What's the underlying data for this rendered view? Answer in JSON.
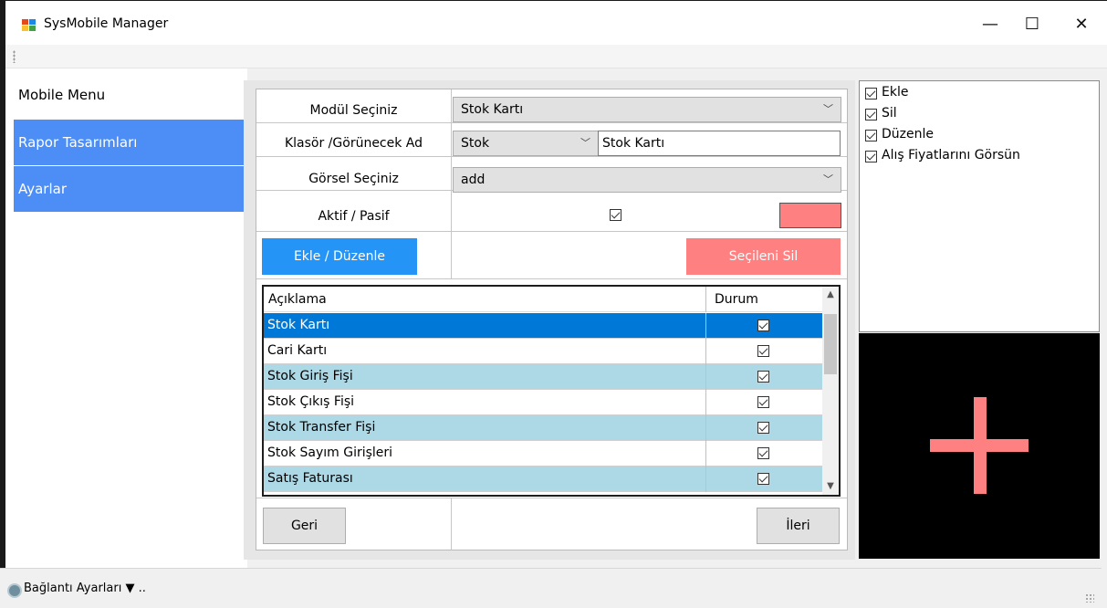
{
  "window": {
    "title": "SysMobile Manager",
    "controls": {
      "minimize": "—",
      "maximize": "☐",
      "close": "✕"
    }
  },
  "sidebar": {
    "items": [
      {
        "label": "Mobile Menu"
      },
      {
        "label": "Rapor Tasarımları"
      },
      {
        "label": "Ayarlar"
      }
    ]
  },
  "form": {
    "module_label": "Modül Seçiniz",
    "module_value": "Stok Kartı",
    "folder_label": "Klasör /Görünecek Ad",
    "folder_value": "Stok",
    "display_name": "Stok Kartı",
    "image_label": "Görsel Seçiniz",
    "image_value": "add",
    "active_label": "Aktif / Pasif",
    "active_checked": true,
    "color": "#ff8080",
    "add_edit_button": "Ekle / Düzenle",
    "delete_button": "Seçileni Sil",
    "back_button": "Geri",
    "next_button": "İleri"
  },
  "grid": {
    "columns": [
      "Açıklama",
      "Durum"
    ],
    "rows": [
      {
        "label": "Stok Kartı",
        "checked": true
      },
      {
        "label": "Cari Kartı",
        "checked": true
      },
      {
        "label": "Stok Giriş Fişi",
        "checked": true
      },
      {
        "label": "Stok Çıkış Fişi",
        "checked": true
      },
      {
        "label": "Stok Transfer Fişi",
        "checked": true
      },
      {
        "label": "Stok Sayım Girişleri",
        "checked": true
      },
      {
        "label": "Satış Faturası",
        "checked": true
      }
    ]
  },
  "permissions": [
    {
      "label": "Ekle",
      "checked": true
    },
    {
      "label": "Sil",
      "checked": true
    },
    {
      "label": "Düzenle",
      "checked": true
    },
    {
      "label": "Alış Fiyatlarını Görsün",
      "checked": true
    }
  ],
  "preview": {
    "icon": "plus-icon",
    "color": "#ff8080"
  },
  "status": {
    "text": "Bağlantı Ayarları ▼ .."
  },
  "colors": {
    "accent_blue": "#2594f7",
    "selected_row": "#0078d7",
    "alt_row": "#add8e6",
    "sidebar_blue": "#4c8df6",
    "danger": "#ff8080"
  }
}
